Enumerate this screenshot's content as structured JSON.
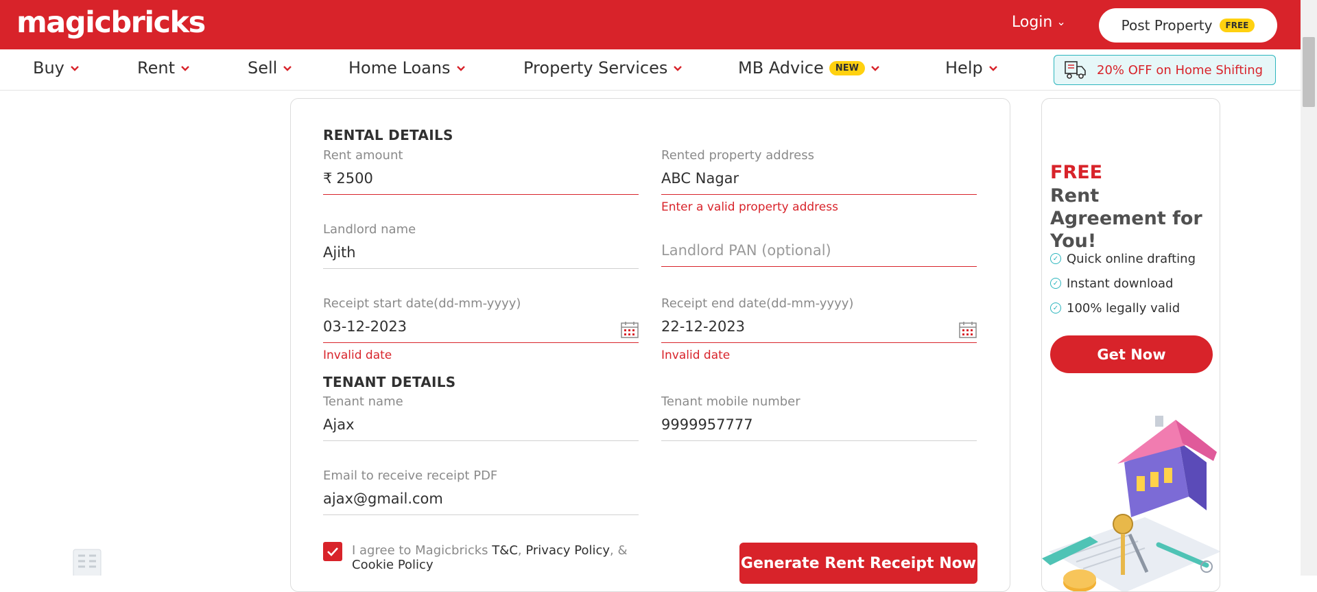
{
  "header": {
    "logo": "magicbricks",
    "login_label": "Login",
    "post_property_label": "Post Property",
    "post_property_badge": "FREE",
    "brand_color": "#d8232a"
  },
  "nav": {
    "items": [
      {
        "label": "Buy"
      },
      {
        "label": "Rent"
      },
      {
        "label": "Sell"
      },
      {
        "label": "Home Loans"
      },
      {
        "label": "Property Services"
      },
      {
        "label": "MB Advice",
        "badge": "NEW"
      },
      {
        "label": "Help"
      }
    ],
    "promo_label": "20% OFF on Home Shifting"
  },
  "form": {
    "rental_title": "RENTAL DETAILS",
    "rent_amount": {
      "label": "Rent amount",
      "currency": "₹",
      "value": "2500"
    },
    "address": {
      "label": "Rented property address",
      "value": "ABC Nagar",
      "error": "Enter a valid property address"
    },
    "landlord_name": {
      "label": "Landlord name",
      "value": "Ajith"
    },
    "landlord_pan": {
      "placeholder": "Landlord PAN (optional)"
    },
    "start_date": {
      "label": "Receipt start date(dd-mm-yyyy)",
      "value": "03-12-2023",
      "error": "Invalid date"
    },
    "end_date": {
      "label": "Receipt end date(dd-mm-yyyy)",
      "value": "22-12-2023",
      "error": "Invalid date"
    },
    "tenant_title": "TENANT DETAILS",
    "tenant_name": {
      "label": "Tenant name",
      "value": "Ajax"
    },
    "tenant_mobile": {
      "label": "Tenant mobile number",
      "value": "9999957777"
    },
    "email": {
      "label": "Email to receive receipt PDF",
      "value": "ajax@gmail.com"
    },
    "agree": {
      "prefix": "I agree to Magicbricks ",
      "tc": "T&C",
      "sep1": ", ",
      "privacy": "Privacy Policy",
      "sep2": ", & ",
      "cookie": "Cookie Policy",
      "checked": true
    },
    "submit_label": "Generate Rent Receipt Now"
  },
  "promo": {
    "free": "FREE",
    "headline": "Rent Agreement for You!",
    "features": [
      "Quick online drafting",
      "Instant download",
      "100% legally valid"
    ],
    "cta": "Get Now",
    "accent": "#2bb5bd"
  }
}
